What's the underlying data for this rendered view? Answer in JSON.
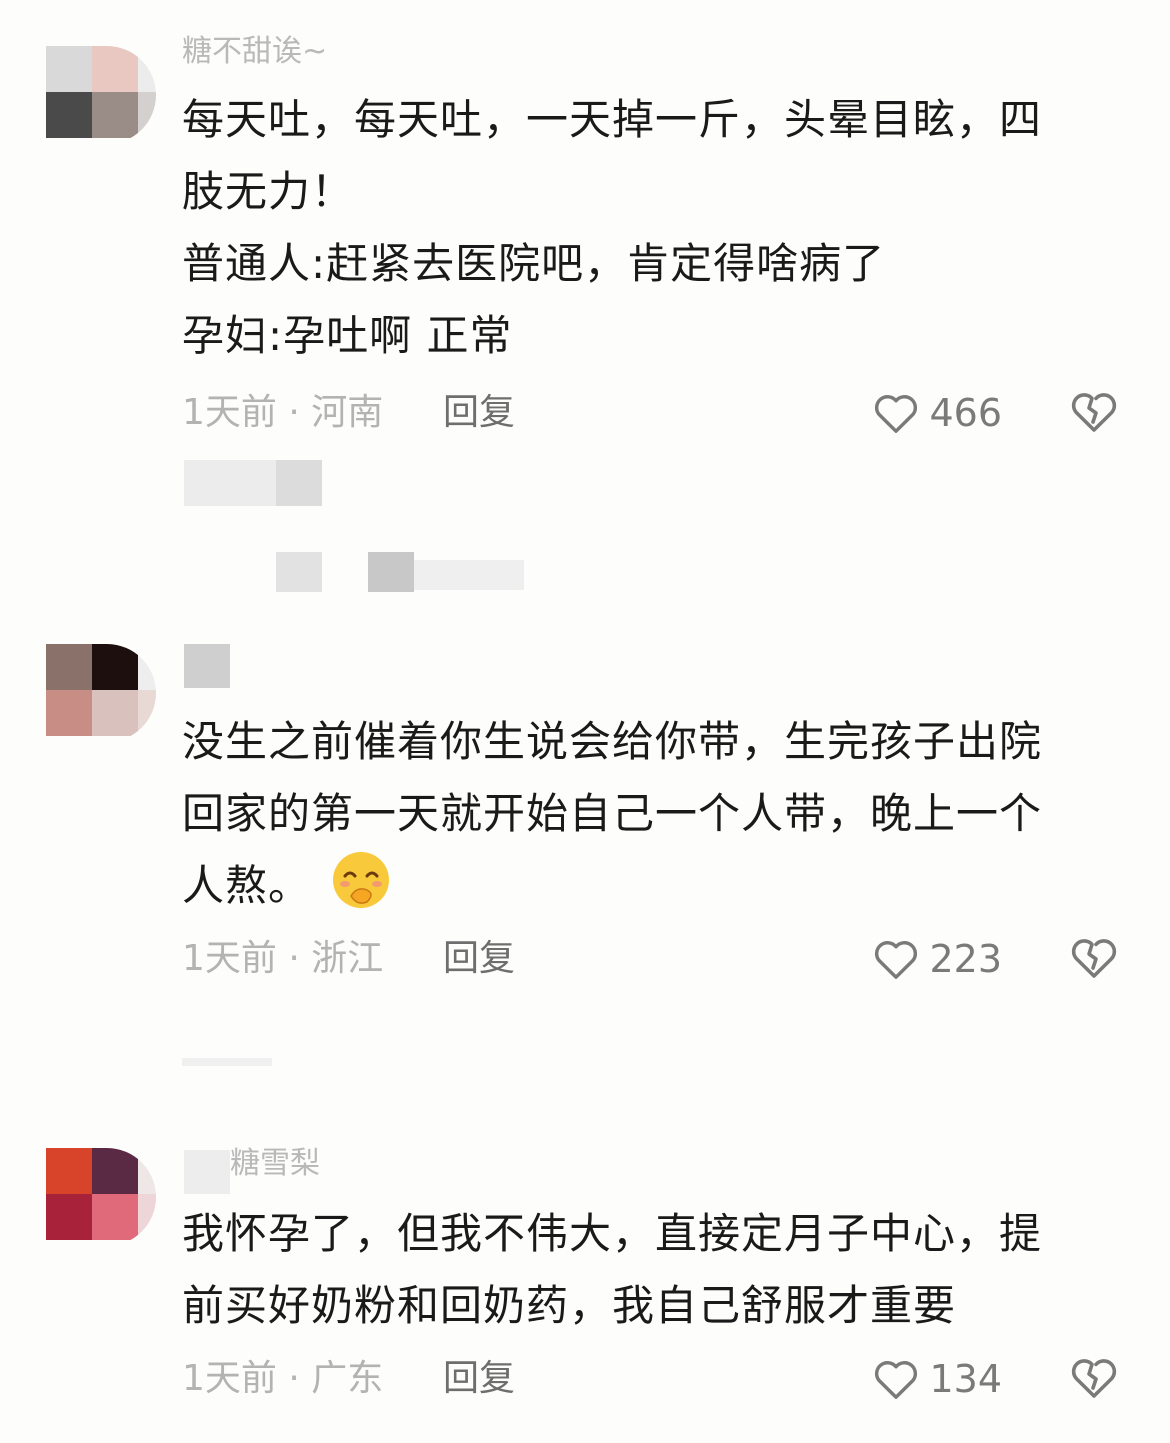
{
  "comments": [
    {
      "username": "糖不甜诶~",
      "lines": [
        "每天吐，每天吐，一天掉一斤，头晕目眩，四",
        "肢无力！",
        "普通人:赶紧去医院吧，肯定得啥病了",
        "孕妇:孕吐啊  正常"
      ],
      "time": "1天前",
      "location": "河南",
      "reply_label": "回复",
      "likes": "466"
    },
    {
      "username": "",
      "lines": [
        "没生之前催着你生说会给你带，生完孩子出院",
        "回家的第一天就开始自己一个人带，晚上一个",
        "人熬。"
      ],
      "emoji": "smirk-emoji",
      "time": "1天前",
      "location": "浙江",
      "reply_label": "回复",
      "likes": "223"
    },
    {
      "username": "糖雪梨",
      "lines": [
        "我怀孕了，但我不伟大，直接定月子中心，提",
        "前买好奶粉和回奶药，我自己舒服才重要"
      ],
      "time": "1天前",
      "location": "广东",
      "reply_label": "回复",
      "likes": "134"
    }
  ],
  "separator": "·",
  "colors": {
    "meta": "#b3b3b3",
    "reply": "#6e6e6e",
    "like": "#7a7a7a",
    "background": "#fdfdfb"
  }
}
